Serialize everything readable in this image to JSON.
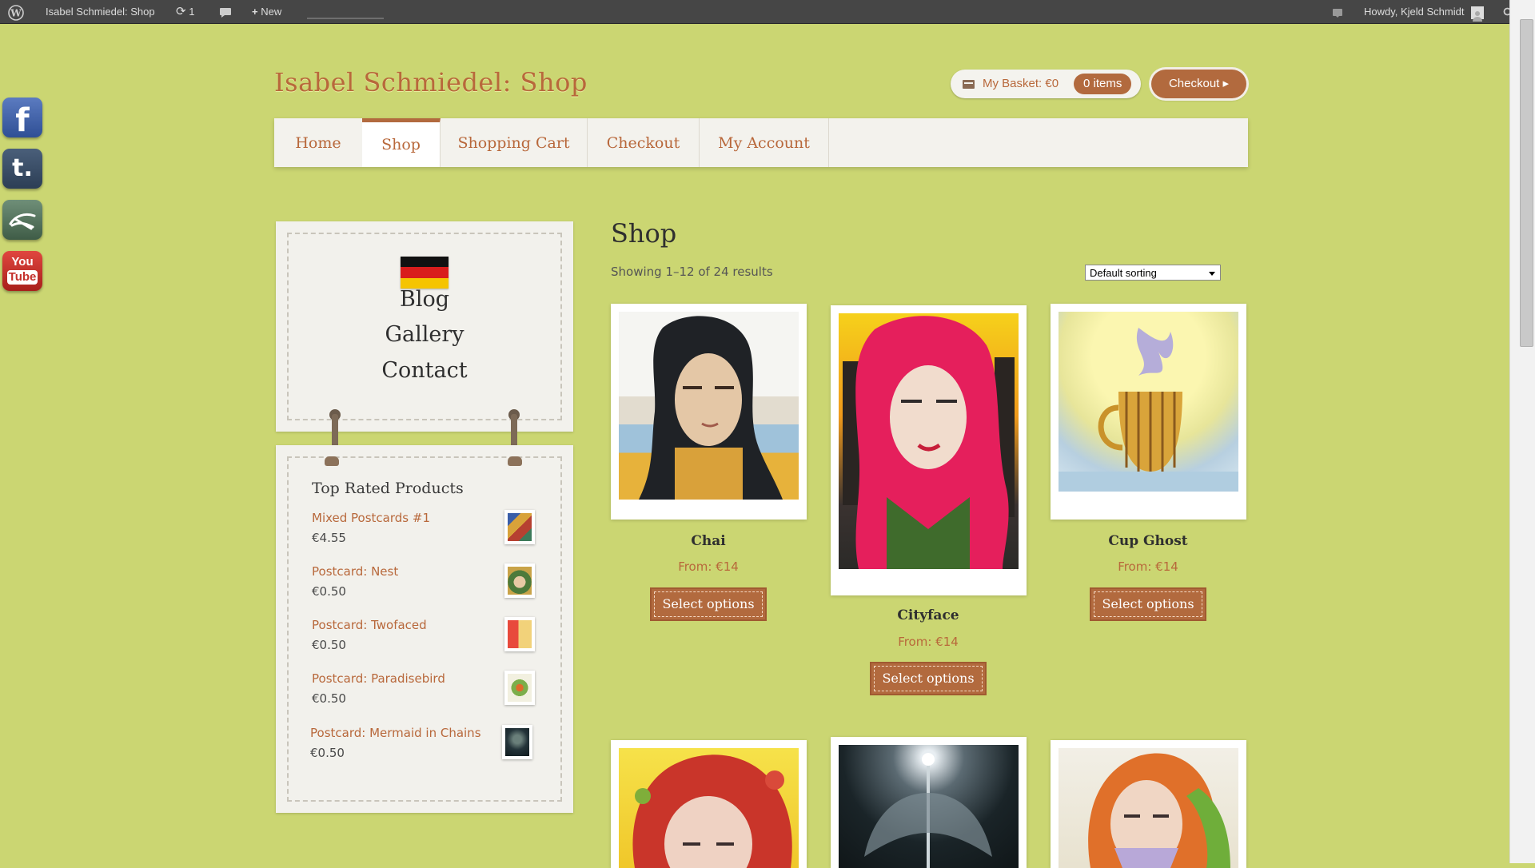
{
  "admin_bar": {
    "site_name": "Isabel Schmiedel: Shop",
    "updates_count": "1",
    "new_label": "New",
    "howdy": "Howdy, Kjeld Schmidt"
  },
  "social": [
    {
      "name": "facebook",
      "glyph": "f",
      "color": "#3b5998"
    },
    {
      "name": "tumblr",
      "glyph": "t.",
      "color": "#35465c"
    },
    {
      "name": "deviantart",
      "glyph": "",
      "color": "#4c6f57"
    },
    {
      "name": "youtube",
      "glyph_top": "You",
      "glyph_bottom": "Tube",
      "color": "#c4302b"
    }
  ],
  "header": {
    "site_title": "Isabel Schmiedel: Shop",
    "basket_label": "My Basket: €0",
    "basket_count": "0 items",
    "checkout_label": "Checkout ▸"
  },
  "nav": [
    "Home",
    "Shop",
    "Shopping Cart",
    "Checkout",
    "My Account"
  ],
  "sidebar": {
    "links": [
      "Blog",
      "Gallery",
      "Contact"
    ],
    "top_rated_title": "Top Rated Products",
    "top_rated": [
      {
        "name": "Mixed Postcards #1",
        "price": "€4.55"
      },
      {
        "name": "Postcard: Nest",
        "price": "€0.50"
      },
      {
        "name": "Postcard: Twofaced",
        "price": "€0.50"
      },
      {
        "name": "Postcard: Paradisebird",
        "price": "€0.50"
      },
      {
        "name": "Postcard: Mermaid in Chains",
        "price": "€0.50"
      }
    ]
  },
  "main": {
    "title": "Shop",
    "result_count": "Showing 1–12 of 24 results",
    "sorting": "Default sorting",
    "products": [
      {
        "name": "Chai",
        "price": "From: €14",
        "button": "Select options"
      },
      {
        "name": "Cityface",
        "price": "From: €14",
        "button": "Select options"
      },
      {
        "name": "Cup Ghost",
        "price": "From: €14",
        "button": "Select options"
      }
    ]
  },
  "colors": {
    "background": "#cbd672",
    "accent": "#b26a3e",
    "title": "#b8683b"
  }
}
